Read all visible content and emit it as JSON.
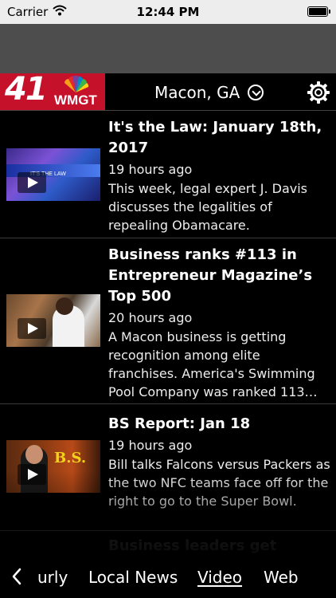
{
  "status": {
    "carrier": "Carrier",
    "time": "12:44 PM"
  },
  "header": {
    "logo_number": "41",
    "logo_call_sign": "WMGT",
    "location": "Macon, GA"
  },
  "stories": [
    {
      "title": "It's the Law: January 18th, 2017",
      "time": "19 hours ago",
      "summary": "This week, legal expert J. Davis discusses the legalities of repealing Obamacare.",
      "thumb_caption": "IT'S THE LAW"
    },
    {
      "title": "Business ranks #113 in Entrepreneur Magazine’s Top 500",
      "time": "20 hours ago",
      "summary": "A Macon business is getting recognition among elite franchises. America's Swimming Pool Company was ranked 113…"
    },
    {
      "title": "BS Report: Jan 18",
      "time": "19 hours ago",
      "summary": "Bill talks Falcons versus Packers as the two NFC teams face off for the right to go to the Super Bowl.",
      "thumb_caption": "B.S."
    },
    {
      "title": "Business leaders get"
    }
  ],
  "tabs": [
    {
      "label": "urly",
      "active": false
    },
    {
      "label": "Local News",
      "active": false
    },
    {
      "label": "Video",
      "active": true
    },
    {
      "label": "Web",
      "active": false
    }
  ],
  "colors": {
    "brand_red": "#c6112b",
    "background": "#000000"
  }
}
